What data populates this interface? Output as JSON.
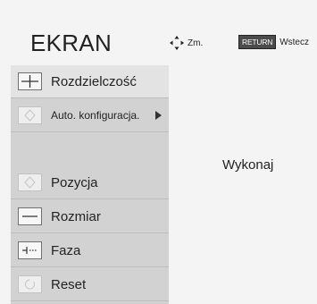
{
  "header": {
    "title": "EKRAN",
    "nav_icon": "four-way-arrow-icon",
    "nav_label": "Zm.",
    "return_key": "RETURN",
    "return_label": "Wstecz"
  },
  "menu": {
    "items": [
      {
        "label": "Rozdzielczość",
        "icon": "crosshair-icon",
        "selected": true
      },
      {
        "label": "Auto. konfiguracja.",
        "icon": "auto-config-icon",
        "submenu_arrow": true
      },
      {
        "label": "Pozycja",
        "icon": "position-icon"
      },
      {
        "label": "Rozmiar",
        "icon": "size-icon"
      },
      {
        "label": "Faza",
        "icon": "phase-icon"
      },
      {
        "label": "Reset",
        "icon": "reset-icon"
      }
    ]
  },
  "panel": {
    "action_label": "Wykonaj"
  }
}
